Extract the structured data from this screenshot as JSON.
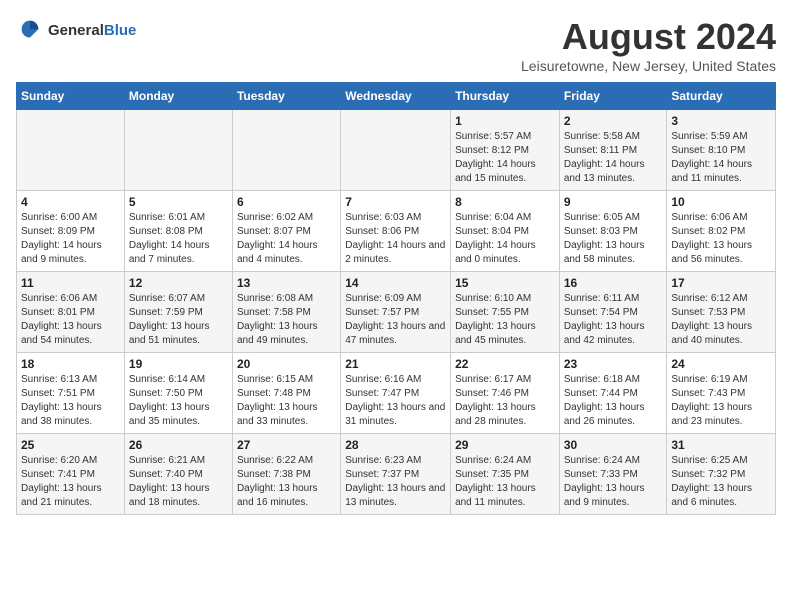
{
  "logo": {
    "general": "General",
    "blue": "Blue"
  },
  "header": {
    "month_title": "August 2024",
    "location": "Leisuretowne, New Jersey, United States"
  },
  "weekdays": [
    "Sunday",
    "Monday",
    "Tuesday",
    "Wednesday",
    "Thursday",
    "Friday",
    "Saturday"
  ],
  "weeks": [
    [
      {
        "day": "",
        "sunrise": "",
        "sunset": "",
        "daylight": ""
      },
      {
        "day": "",
        "sunrise": "",
        "sunset": "",
        "daylight": ""
      },
      {
        "day": "",
        "sunrise": "",
        "sunset": "",
        "daylight": ""
      },
      {
        "day": "",
        "sunrise": "",
        "sunset": "",
        "daylight": ""
      },
      {
        "day": "1",
        "sunrise": "Sunrise: 5:57 AM",
        "sunset": "Sunset: 8:12 PM",
        "daylight": "Daylight: 14 hours and 15 minutes."
      },
      {
        "day": "2",
        "sunrise": "Sunrise: 5:58 AM",
        "sunset": "Sunset: 8:11 PM",
        "daylight": "Daylight: 14 hours and 13 minutes."
      },
      {
        "day": "3",
        "sunrise": "Sunrise: 5:59 AM",
        "sunset": "Sunset: 8:10 PM",
        "daylight": "Daylight: 14 hours and 11 minutes."
      }
    ],
    [
      {
        "day": "4",
        "sunrise": "Sunrise: 6:00 AM",
        "sunset": "Sunset: 8:09 PM",
        "daylight": "Daylight: 14 hours and 9 minutes."
      },
      {
        "day": "5",
        "sunrise": "Sunrise: 6:01 AM",
        "sunset": "Sunset: 8:08 PM",
        "daylight": "Daylight: 14 hours and 7 minutes."
      },
      {
        "day": "6",
        "sunrise": "Sunrise: 6:02 AM",
        "sunset": "Sunset: 8:07 PM",
        "daylight": "Daylight: 14 hours and 4 minutes."
      },
      {
        "day": "7",
        "sunrise": "Sunrise: 6:03 AM",
        "sunset": "Sunset: 8:06 PM",
        "daylight": "Daylight: 14 hours and 2 minutes."
      },
      {
        "day": "8",
        "sunrise": "Sunrise: 6:04 AM",
        "sunset": "Sunset: 8:04 PM",
        "daylight": "Daylight: 14 hours and 0 minutes."
      },
      {
        "day": "9",
        "sunrise": "Sunrise: 6:05 AM",
        "sunset": "Sunset: 8:03 PM",
        "daylight": "Daylight: 13 hours and 58 minutes."
      },
      {
        "day": "10",
        "sunrise": "Sunrise: 6:06 AM",
        "sunset": "Sunset: 8:02 PM",
        "daylight": "Daylight: 13 hours and 56 minutes."
      }
    ],
    [
      {
        "day": "11",
        "sunrise": "Sunrise: 6:06 AM",
        "sunset": "Sunset: 8:01 PM",
        "daylight": "Daylight: 13 hours and 54 minutes."
      },
      {
        "day": "12",
        "sunrise": "Sunrise: 6:07 AM",
        "sunset": "Sunset: 7:59 PM",
        "daylight": "Daylight: 13 hours and 51 minutes."
      },
      {
        "day": "13",
        "sunrise": "Sunrise: 6:08 AM",
        "sunset": "Sunset: 7:58 PM",
        "daylight": "Daylight: 13 hours and 49 minutes."
      },
      {
        "day": "14",
        "sunrise": "Sunrise: 6:09 AM",
        "sunset": "Sunset: 7:57 PM",
        "daylight": "Daylight: 13 hours and 47 minutes."
      },
      {
        "day": "15",
        "sunrise": "Sunrise: 6:10 AM",
        "sunset": "Sunset: 7:55 PM",
        "daylight": "Daylight: 13 hours and 45 minutes."
      },
      {
        "day": "16",
        "sunrise": "Sunrise: 6:11 AM",
        "sunset": "Sunset: 7:54 PM",
        "daylight": "Daylight: 13 hours and 42 minutes."
      },
      {
        "day": "17",
        "sunrise": "Sunrise: 6:12 AM",
        "sunset": "Sunset: 7:53 PM",
        "daylight": "Daylight: 13 hours and 40 minutes."
      }
    ],
    [
      {
        "day": "18",
        "sunrise": "Sunrise: 6:13 AM",
        "sunset": "Sunset: 7:51 PM",
        "daylight": "Daylight: 13 hours and 38 minutes."
      },
      {
        "day": "19",
        "sunrise": "Sunrise: 6:14 AM",
        "sunset": "Sunset: 7:50 PM",
        "daylight": "Daylight: 13 hours and 35 minutes."
      },
      {
        "day": "20",
        "sunrise": "Sunrise: 6:15 AM",
        "sunset": "Sunset: 7:48 PM",
        "daylight": "Daylight: 13 hours and 33 minutes."
      },
      {
        "day": "21",
        "sunrise": "Sunrise: 6:16 AM",
        "sunset": "Sunset: 7:47 PM",
        "daylight": "Daylight: 13 hours and 31 minutes."
      },
      {
        "day": "22",
        "sunrise": "Sunrise: 6:17 AM",
        "sunset": "Sunset: 7:46 PM",
        "daylight": "Daylight: 13 hours and 28 minutes."
      },
      {
        "day": "23",
        "sunrise": "Sunrise: 6:18 AM",
        "sunset": "Sunset: 7:44 PM",
        "daylight": "Daylight: 13 hours and 26 minutes."
      },
      {
        "day": "24",
        "sunrise": "Sunrise: 6:19 AM",
        "sunset": "Sunset: 7:43 PM",
        "daylight": "Daylight: 13 hours and 23 minutes."
      }
    ],
    [
      {
        "day": "25",
        "sunrise": "Sunrise: 6:20 AM",
        "sunset": "Sunset: 7:41 PM",
        "daylight": "Daylight: 13 hours and 21 minutes."
      },
      {
        "day": "26",
        "sunrise": "Sunrise: 6:21 AM",
        "sunset": "Sunset: 7:40 PM",
        "daylight": "Daylight: 13 hours and 18 minutes."
      },
      {
        "day": "27",
        "sunrise": "Sunrise: 6:22 AM",
        "sunset": "Sunset: 7:38 PM",
        "daylight": "Daylight: 13 hours and 16 minutes."
      },
      {
        "day": "28",
        "sunrise": "Sunrise: 6:23 AM",
        "sunset": "Sunset: 7:37 PM",
        "daylight": "Daylight: 13 hours and 13 minutes."
      },
      {
        "day": "29",
        "sunrise": "Sunrise: 6:24 AM",
        "sunset": "Sunset: 7:35 PM",
        "daylight": "Daylight: 13 hours and 11 minutes."
      },
      {
        "day": "30",
        "sunrise": "Sunrise: 6:24 AM",
        "sunset": "Sunset: 7:33 PM",
        "daylight": "Daylight: 13 hours and 9 minutes."
      },
      {
        "day": "31",
        "sunrise": "Sunrise: 6:25 AM",
        "sunset": "Sunset: 7:32 PM",
        "daylight": "Daylight: 13 hours and 6 minutes."
      }
    ]
  ]
}
